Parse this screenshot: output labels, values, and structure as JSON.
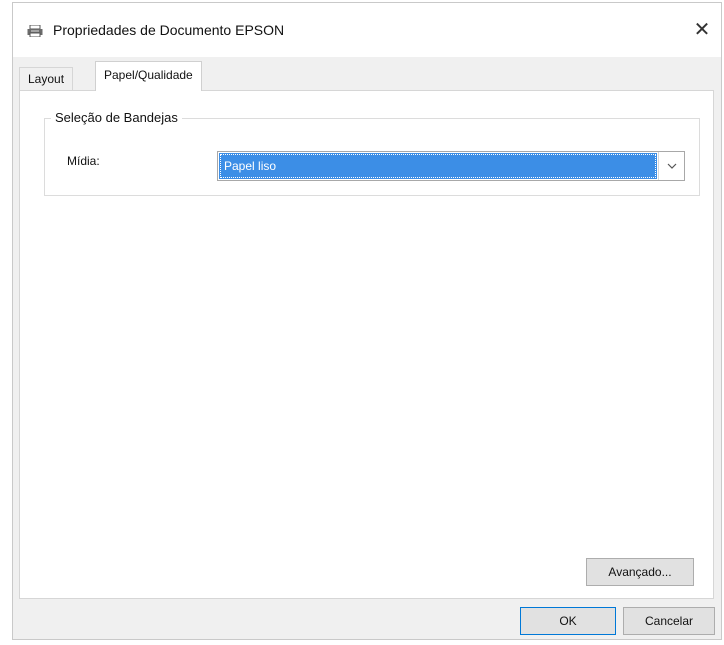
{
  "window": {
    "title": "Propriedades de Documento EPSON",
    "close_symbol": "✕",
    "title_icon": "printer-icon"
  },
  "tabs": [
    {
      "label": "Layout",
      "active": false
    },
    {
      "label": "Papel/Qualidade",
      "active": true
    }
  ],
  "tray_selection": {
    "legend": "Seleção de Bandejas",
    "media_label": "Mídia:",
    "media_value": "Papel liso",
    "dropdown_icon": "chevron-down-icon"
  },
  "buttons": {
    "advanced": "Avançado...",
    "ok": "OK",
    "cancel": "Cancelar"
  },
  "colors": {
    "selection_highlight": "#3c8ee6",
    "default_button_border": "#0078d7"
  }
}
